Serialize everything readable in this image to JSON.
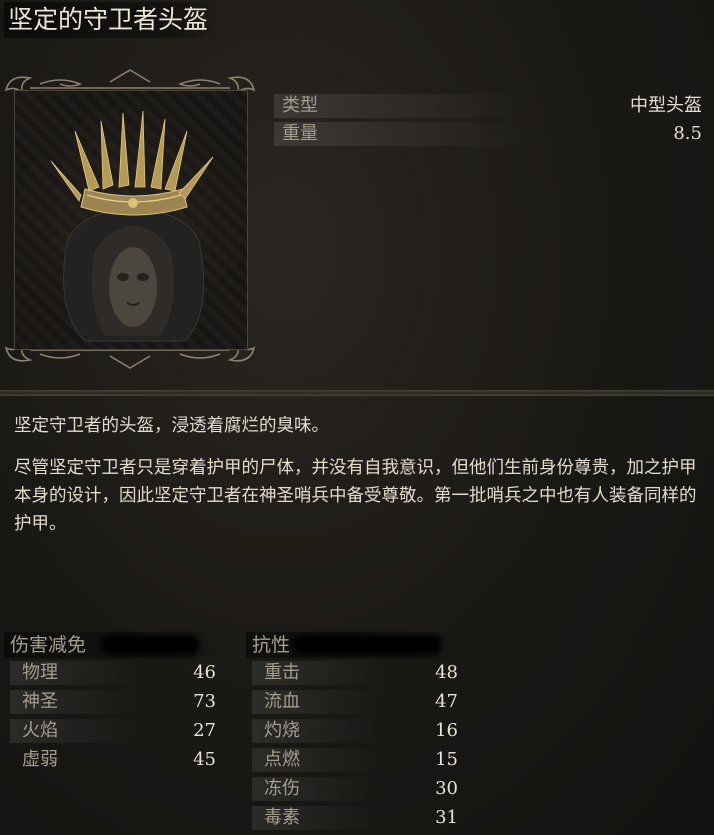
{
  "item": {
    "name": "坚定的守卫者头盔",
    "type_label": "类型",
    "type_value": "中型头盔",
    "weight_label": "重量",
    "weight_value": "8.5"
  },
  "description": {
    "lines": [
      "坚定守卫者的头盔，浸透着腐烂的臭味。",
      "尽管坚定守卫者只是穿着护甲的尸体，并没有自我意识，但他们生前身份尊贵，加之护甲本身的设计，因此坚定守卫者在神圣哨兵中备受尊敬。第一批哨兵之中也有人装备同样的护甲。"
    ]
  },
  "damage_negation": {
    "header": "伤害减免",
    "rows": [
      {
        "label": "物理",
        "value": "46"
      },
      {
        "label": "神圣",
        "value": "73"
      },
      {
        "label": "火焰",
        "value": "27"
      },
      {
        "label": "虚弱",
        "value": "45"
      }
    ]
  },
  "resistance": {
    "header": "抗性",
    "rows": [
      {
        "label": "重击",
        "value": "48"
      },
      {
        "label": "流血",
        "value": "47"
      },
      {
        "label": "灼烧",
        "value": "16"
      },
      {
        "label": "点燃",
        "value": "15"
      },
      {
        "label": "冻伤",
        "value": "30"
      },
      {
        "label": "毒素",
        "value": "31"
      }
    ]
  },
  "colors": {
    "background": "#1b1916",
    "label": "#a49e8e",
    "value": "#e8e2d4",
    "gold": "#b59a55"
  }
}
